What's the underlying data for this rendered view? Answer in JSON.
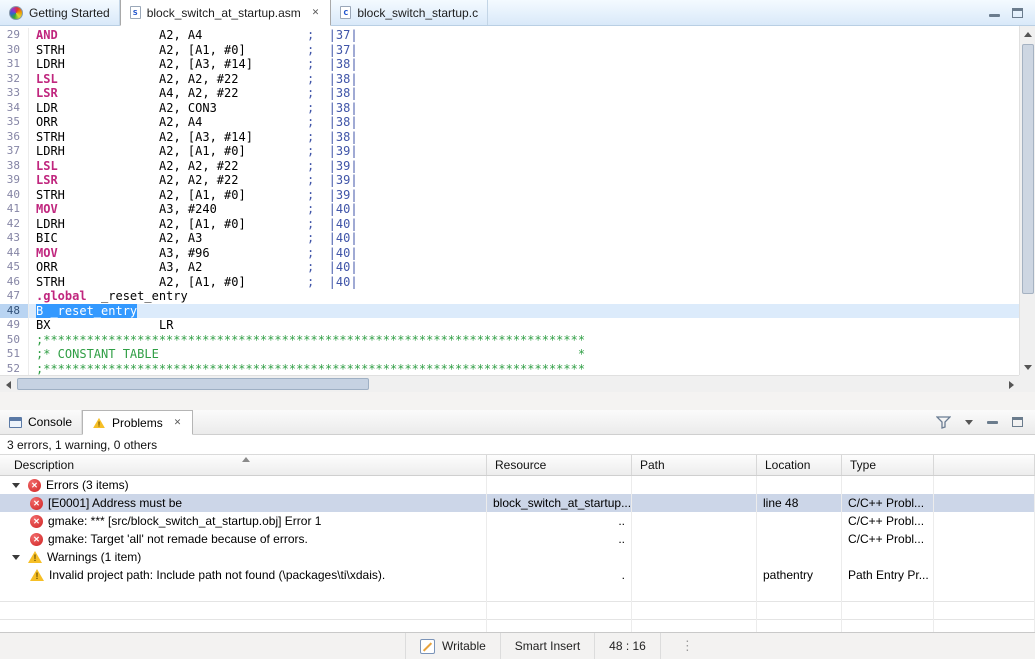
{
  "editor_tabs": [
    {
      "label": "Getting Started",
      "icon": "getting-started-icon",
      "active": false,
      "closable": false
    },
    {
      "label": "block_switch_at_startup.asm",
      "icon": "asm-file-icon",
      "active": true,
      "closable": true
    },
    {
      "label": "block_switch_startup.c",
      "icon": "c-file-icon",
      "active": false,
      "closable": false
    }
  ],
  "editor": {
    "lines": [
      {
        "n": 29,
        "k": "i",
        "kw": true,
        "m": "AND",
        "o": "A2, A4",
        "c": ";  |37|"
      },
      {
        "n": 30,
        "k": "i",
        "kw": false,
        "m": "STRH",
        "o": "A2, [A1, #0]",
        "c": ";  |37|"
      },
      {
        "n": 31,
        "k": "i",
        "kw": false,
        "m": "LDRH",
        "o": "A2, [A3, #14]",
        "c": ";  |38|"
      },
      {
        "n": 32,
        "k": "i",
        "kw": true,
        "m": "LSL",
        "o": "A2, A2, #22",
        "c": ";  |38|"
      },
      {
        "n": 33,
        "k": "i",
        "kw": true,
        "m": "LSR",
        "o": "A4, A2, #22",
        "c": ";  |38|"
      },
      {
        "n": 34,
        "k": "i",
        "kw": false,
        "m": "LDR",
        "o": "A2, CON3",
        "c": ";  |38|"
      },
      {
        "n": 35,
        "k": "i",
        "kw": false,
        "m": "ORR",
        "o": "A2, A4",
        "c": ";  |38|"
      },
      {
        "n": 36,
        "k": "i",
        "kw": false,
        "m": "STRH",
        "o": "A2, [A3, #14]",
        "c": ";  |38|"
      },
      {
        "n": 37,
        "k": "i",
        "kw": false,
        "m": "LDRH",
        "o": "A2, [A1, #0]",
        "c": ";  |39|"
      },
      {
        "n": 38,
        "k": "i",
        "kw": true,
        "m": "LSL",
        "o": "A2, A2, #22",
        "c": ";  |39|"
      },
      {
        "n": 39,
        "k": "i",
        "kw": true,
        "m": "LSR",
        "o": "A2, A2, #22",
        "c": ";  |39|"
      },
      {
        "n": 40,
        "k": "i",
        "kw": false,
        "m": "STRH",
        "o": "A2, [A1, #0]",
        "c": ";  |39|"
      },
      {
        "n": 41,
        "k": "i",
        "kw": true,
        "m": "MOV",
        "o": "A3, #240",
        "c": ";  |40|"
      },
      {
        "n": 42,
        "k": "i",
        "kw": false,
        "m": "LDRH",
        "o": "A2, [A1, #0]",
        "c": ";  |40|"
      },
      {
        "n": 43,
        "k": "i",
        "kw": false,
        "m": "BIC",
        "o": "A2, A3",
        "c": ";  |40|"
      },
      {
        "n": 44,
        "k": "i",
        "kw": true,
        "m": "MOV",
        "o": "A3, #96",
        "c": ";  |40|"
      },
      {
        "n": 45,
        "k": "i",
        "kw": false,
        "m": "ORR",
        "o": "A3, A2",
        "c": ";  |40|"
      },
      {
        "n": 46,
        "k": "i",
        "kw": false,
        "m": "STRH",
        "o": "A2, [A1, #0]",
        "c": ";  |40|"
      },
      {
        "n": 47,
        "k": "d",
        "m": ".global",
        "o": "  _reset_entry"
      },
      {
        "n": 48,
        "k": "s",
        "t": "B _reset_entry"
      },
      {
        "n": 49,
        "k": "i",
        "kw": false,
        "m": "BX",
        "o": "LR",
        "c": ""
      },
      {
        "n": 50,
        "k": "c",
        "t": ";***************************************************************************"
      },
      {
        "n": 51,
        "k": "c",
        "t": ";* CONSTANT TABLE                                                          *"
      },
      {
        "n": 52,
        "k": "c",
        "t": ";***************************************************************************"
      }
    ]
  },
  "panel": {
    "tabs": [
      {
        "label": "Console",
        "icon": "console-icon",
        "active": false,
        "closable": false
      },
      {
        "label": "Problems",
        "icon": "problems-icon",
        "active": true,
        "closable": true
      }
    ],
    "summary": "3 errors, 1 warning, 0 others",
    "table": {
      "columns": [
        "Description",
        "Resource",
        "Path",
        "Location",
        "Type"
      ],
      "rows": [
        {
          "kind": "group",
          "icon": "error",
          "text": "Errors (3 items)"
        },
        {
          "kind": "item",
          "icon": "error",
          "selected": true,
          "description": "[E0001] Address must be",
          "resource": "block_switch_at_startup...",
          "path": "",
          "location": "line 48",
          "type": "C/C++ Probl..."
        },
        {
          "kind": "item",
          "icon": "error",
          "description": "gmake: *** [src/block_switch_at_startup.obj] Error 1",
          "resource": "..",
          "resource_align": "right",
          "path": "",
          "location": "",
          "type": "C/C++ Probl..."
        },
        {
          "kind": "item",
          "icon": "error",
          "description": "gmake: Target 'all' not remade because of errors.",
          "resource": "..",
          "resource_align": "right",
          "path": "",
          "location": "",
          "type": "C/C++ Probl..."
        },
        {
          "kind": "group",
          "icon": "warning",
          "text": "Warnings (1 item)"
        },
        {
          "kind": "item",
          "icon": "warning",
          "description": "Invalid project path: Include path not found (\\packages\\ti\\xdais).",
          "resource": ".",
          "resource_align": "right",
          "path": "",
          "location": "pathentry",
          "type": "Path Entry Pr..."
        }
      ]
    }
  },
  "statusbar": {
    "writable": "Writable",
    "insert_mode": "Smart Insert",
    "caret_position": "48 : 16"
  },
  "icons": {
    "close": "✕",
    "getting-started": "colorful pinwheel circle",
    "asm-file": "document with letter s",
    "c-file": "document with letter c",
    "console": "terminal window",
    "problems": "warning triangle",
    "error": "red circle with white x",
    "warning": "yellow triangle with exclamation",
    "sort": "up triangle",
    "filter": "funnel",
    "view-menu": "down triangle",
    "minimize": "horizontal bar",
    "maximize": "square outline",
    "overflow-dots": "⋮"
  },
  "colors": {
    "keyword": "#c0267e",
    "comment_line_ref": "#4055a8",
    "comment_block": "#2f9e44",
    "selection_bg": "#3399ff",
    "selected_line_bg": "#dcebfb",
    "error": "#d32f2f",
    "warning": "#f6bf26",
    "row_selection": "#ccd6e8"
  }
}
